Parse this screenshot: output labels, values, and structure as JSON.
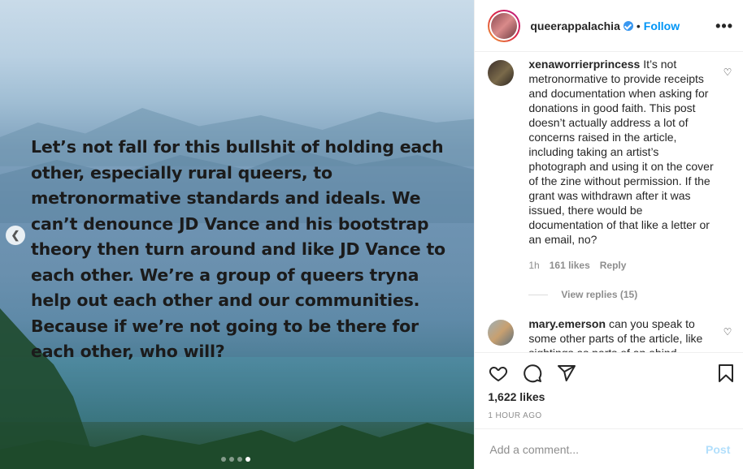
{
  "post": {
    "username": "queerappalachia",
    "separator": "•",
    "follow_label": "Follow",
    "more_label": "•••",
    "quote": "Let’s not fall for this bullshit of holding each other, especially rural queers, to metronormative standards and ideals. We can’t denounce JD Vance and his bootstrap theory then turn around and like JD Vance to each other. We’re a group of queers tryna help out each other and our communities. Because if we’re not going to be there for each other, who will?",
    "carousel_prev_icon": "chevron-left-icon",
    "carousel_dots": 4,
    "carousel_active_dot": 4
  },
  "comments": [
    {
      "user": "xenaworrierprincess",
      "text": "It’s not metronormative to provide receipts and documentation when asking for donations in good faith. This post doesn’t actually address a lot of concerns raised in the article, including taking an artist’s photograph and using it on the cover of the zine without permission. If the grant was withdrawn after it was issued, there would be documentation of that like a letter or an email, no?",
      "time": "1h",
      "likes": "161 likes",
      "reply_label": "Reply",
      "view_replies": "View replies (15)"
    },
    {
      "user": "mary.emerson",
      "text": "can you speak to some other parts of the article, like sightings as parts of an abind"
    }
  ],
  "actions": {
    "likes": "1,622 likes",
    "time": "1 HOUR AGO",
    "comment_placeholder": "Add a comment...",
    "post_label": "Post"
  },
  "colors": {
    "accent": "#0095f6",
    "post_disabled": "#b2dffc",
    "muted": "#8e8e8e"
  }
}
